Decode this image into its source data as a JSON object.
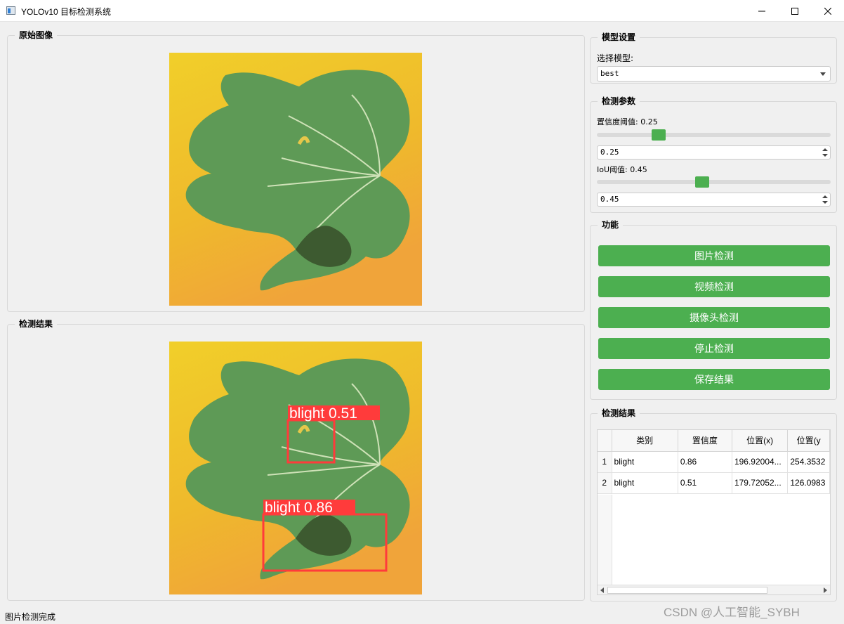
{
  "window": {
    "title": "YOLOv10 目标检测系统"
  },
  "panels": {
    "original_title": "原始图像",
    "result_title": "检测结果"
  },
  "model_settings": {
    "group_title": "模型设置",
    "select_label": "选择模型:",
    "selected_model": "best"
  },
  "detect_params": {
    "group_title": "检测参数",
    "conf_label": "置信度阈值: 0.25",
    "conf_value": "0.25",
    "conf_fraction": 0.25,
    "iou_label": "IoU阈值: 0.45",
    "iou_value": "0.45",
    "iou_fraction": 0.45
  },
  "functions": {
    "group_title": "功能",
    "image_detect": "图片检测",
    "video_detect": "视频检测",
    "camera_detect": "摄像头检测",
    "stop_detect": "停止检测",
    "save_result": "保存结果"
  },
  "results_table": {
    "group_title": "检测结果",
    "columns": [
      "类别",
      "置信度",
      "位置(x)",
      "位置(y"
    ],
    "rows": [
      {
        "index": "1",
        "cls": "blight",
        "conf": "0.86",
        "x": "196.92004...",
        "y": "254.3532"
      },
      {
        "index": "2",
        "cls": "blight",
        "conf": "0.51",
        "x": "179.72052...",
        "y": "126.0983"
      }
    ]
  },
  "detections": [
    {
      "label": "blight 0.51"
    },
    {
      "label": "blight 0.86"
    }
  ],
  "status": {
    "text": "图片检测完成"
  },
  "watermark": "CSDN @人工智能_SYBH",
  "colors": {
    "accent_green": "#4caf50",
    "box_red": "#ff3b3b"
  }
}
